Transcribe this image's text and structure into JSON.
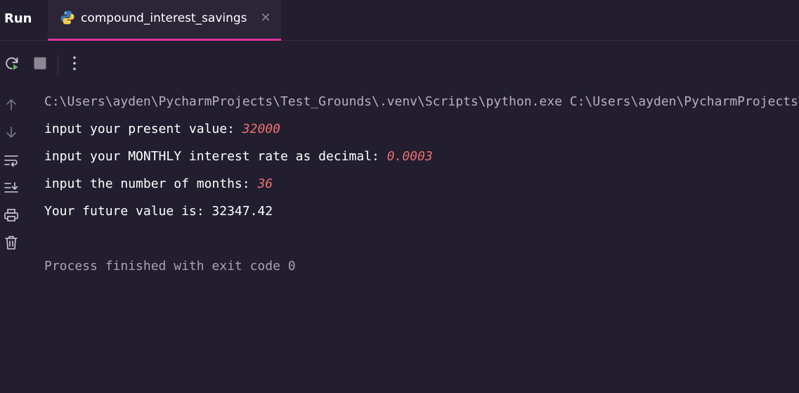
{
  "tool_window": {
    "title": "Run"
  },
  "tab": {
    "label": "compound_interest_savings",
    "icon": "python-icon",
    "close_icon": "close-icon"
  },
  "toolbar": {
    "rerun_icon": "rerun-icon",
    "stop_icon": "stop-icon",
    "more_icon": "more-options-icon"
  },
  "sidebar": {
    "items": [
      {
        "icon": "arrow-up-icon"
      },
      {
        "icon": "arrow-down-icon"
      },
      {
        "icon": "soft-wrap-icon"
      },
      {
        "icon": "scroll-to-end-icon"
      },
      {
        "icon": "print-icon"
      },
      {
        "icon": "trash-icon"
      }
    ]
  },
  "console": {
    "command": "C:\\Users\\ayden\\PycharmProjects\\Test_Grounds\\.venv\\Scripts\\python.exe C:\\Users\\ayden\\PycharmProjects\\Test_Grounds\\compound_interest_savings.py",
    "lines": [
      {
        "prompt": "input your present value: ",
        "input": "32000"
      },
      {
        "prompt": "input your MONTHLY interest rate as decimal: ",
        "input": "0.0003"
      },
      {
        "prompt": "input the number of months: ",
        "input": "36"
      }
    ],
    "result": "Your future value is: 32347.42",
    "exit": "Process finished with exit code 0"
  },
  "colors": {
    "background": "#221e2f",
    "accent": "#e1359c",
    "user_input": "#ee6f6f"
  }
}
